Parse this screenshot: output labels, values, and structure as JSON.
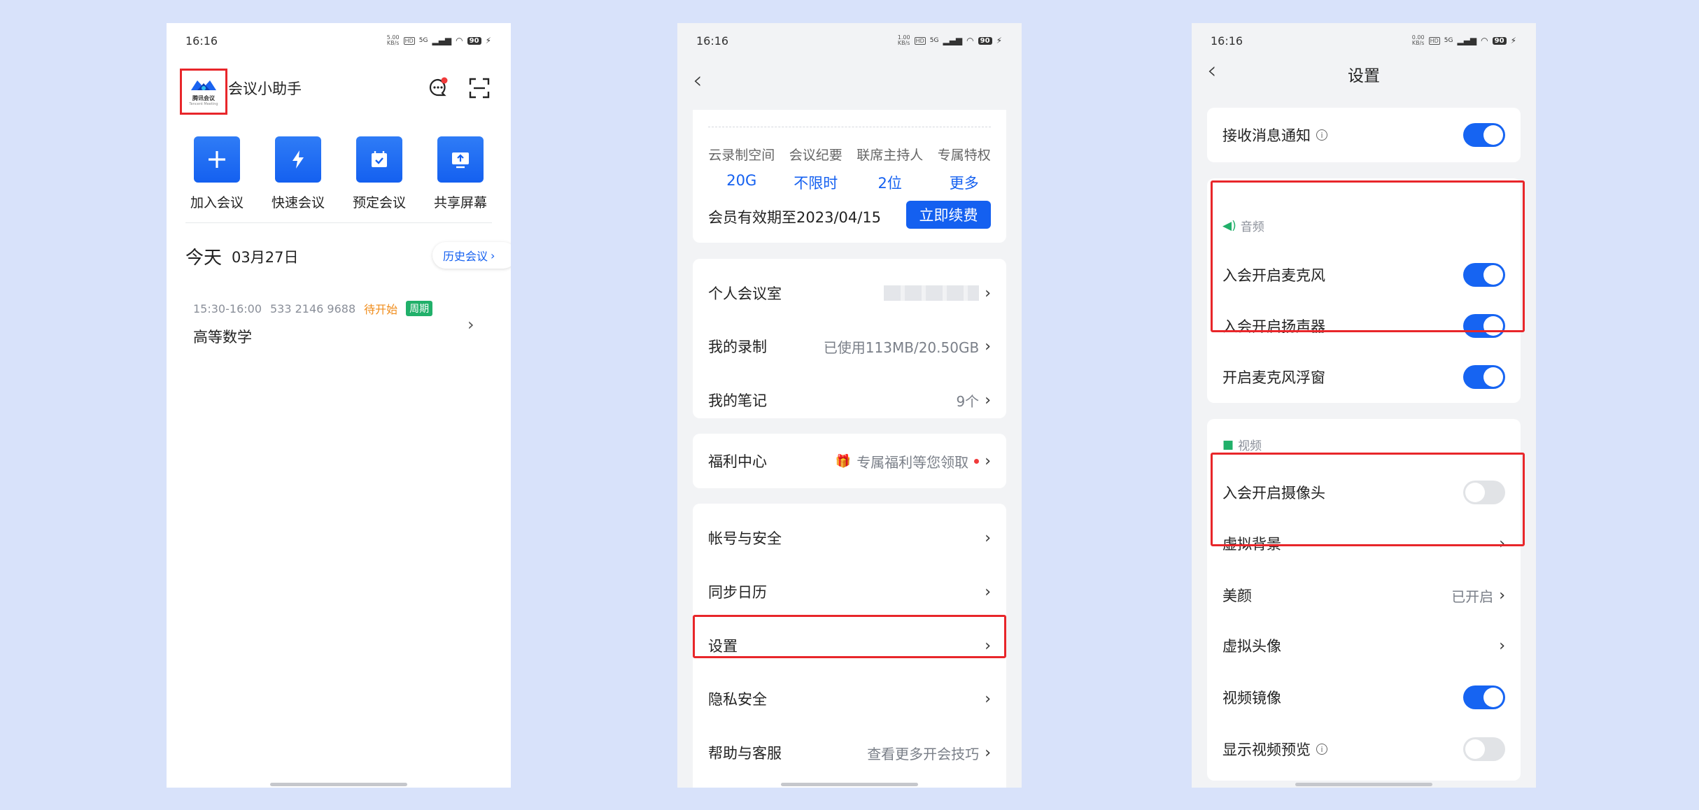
{
  "status": {
    "time": "16:16",
    "battery": "90",
    "net_speed_1": "5.00",
    "net_speed_2": "1.00",
    "net_speed_3": "0.00",
    "net_unit": "KB/s",
    "hd": "HD",
    "g5": "5G"
  },
  "home": {
    "logo_text": "腾讯会议",
    "logo_sub": "Tencent Meeting",
    "app_name": "会议小助手",
    "actions": [
      {
        "label": "加入会议",
        "icon": "plus-icon"
      },
      {
        "label": "快速会议",
        "icon": "lightning-icon"
      },
      {
        "label": "预定会议",
        "icon": "calendar-check-icon"
      },
      {
        "label": "共享屏幕",
        "icon": "share-screen-icon"
      }
    ],
    "today_label": "今天",
    "today_date": "03月27日",
    "history_btn": "历史会议",
    "meeting": {
      "time": "15:30-16:00",
      "id": "533 2146 9688",
      "status": "待开始",
      "badge": "周期",
      "title": "高等数学"
    }
  },
  "profile": {
    "quotas": [
      {
        "label": "云录制空间",
        "value": "20G"
      },
      {
        "label": "会议纪要",
        "value": "不限时"
      },
      {
        "label": "联席主持人",
        "value": "2位"
      },
      {
        "label": "专属特权",
        "value": "更多"
      }
    ],
    "expire_text": "会员有效期至2023/04/15",
    "renew_btn": "立即续费",
    "group1": [
      {
        "label": "个人会议室",
        "value": ""
      },
      {
        "label": "我的录制",
        "value": "已使用113MB/20.50GB"
      },
      {
        "label": "我的笔记",
        "value": "9个"
      }
    ],
    "welfare": {
      "label": "福利中心",
      "value": "专属福利等您领取"
    },
    "group3": [
      {
        "label": "帐号与安全"
      },
      {
        "label": "同步日历"
      },
      {
        "label": "设置"
      },
      {
        "label": "隐私安全"
      },
      {
        "label": "帮助与客服",
        "value": "查看更多开会技巧"
      }
    ]
  },
  "settings": {
    "title": "设置",
    "notify": {
      "label": "接收消息通知",
      "on": true
    },
    "audio_header": "音频",
    "audio": [
      {
        "label": "入会开启麦克风",
        "on": true
      },
      {
        "label": "入会开启扬声器",
        "on": true
      },
      {
        "label": "开启麦克风浮窗",
        "on": true
      }
    ],
    "video_header": "视频",
    "video": [
      {
        "label": "入会开启摄像头",
        "on": false
      },
      {
        "label": "虚拟背景",
        "value": ""
      },
      {
        "label": "美颜",
        "value": "已开启"
      },
      {
        "label": "虚拟头像",
        "value": ""
      },
      {
        "label": "视频镜像",
        "on": true
      },
      {
        "label": "显示视频预览",
        "on": false
      }
    ]
  },
  "colors": {
    "accent": "#1460f0",
    "highlight": "#e8262a",
    "badge_green": "#21b06a",
    "status_orange": "#f08c1a"
  }
}
